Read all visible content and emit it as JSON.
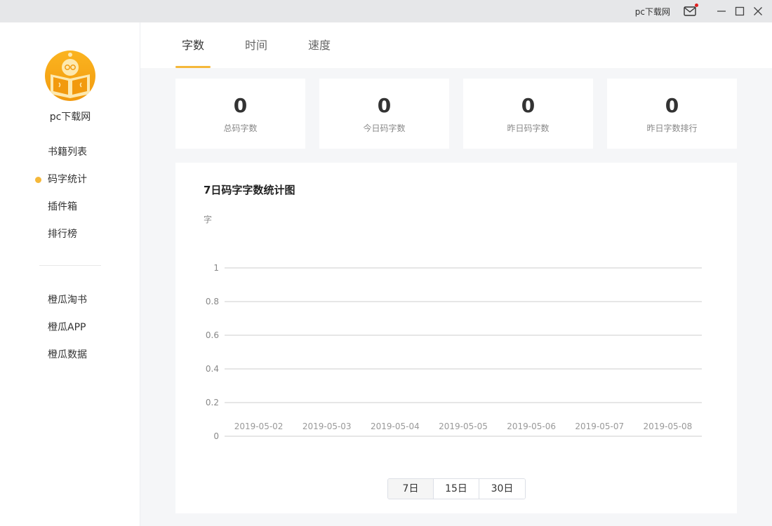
{
  "titlebar": {
    "user_label": "pc下载网",
    "icons": [
      "mail-icon",
      "minimize-icon",
      "maximize-icon",
      "close-icon"
    ],
    "notification_dot_color": "#e02020"
  },
  "sidebar": {
    "brand": "pc下载网",
    "primary_items": [
      {
        "label": "书籍列表",
        "active": false
      },
      {
        "label": "码字统计",
        "active": true
      },
      {
        "label": "插件箱",
        "active": false
      },
      {
        "label": "排行榜",
        "active": false
      }
    ],
    "secondary_items": [
      {
        "label": "橙瓜淘书"
      },
      {
        "label": "橙瓜APP"
      },
      {
        "label": "橙瓜数据"
      }
    ]
  },
  "tabs": [
    {
      "label": "字数",
      "active": true
    },
    {
      "label": "时间",
      "active": false
    },
    {
      "label": "速度",
      "active": false
    }
  ],
  "stats": [
    {
      "value": "0",
      "label": "总码字数"
    },
    {
      "value": "0",
      "label": "今日码字数"
    },
    {
      "value": "0",
      "label": "昨日码字数"
    },
    {
      "value": "0",
      "label": "昨日字数排行"
    }
  ],
  "chart_data": {
    "type": "line",
    "title": "7日码字字数统计图",
    "ylabel": "字",
    "xlabel": "",
    "categories": [
      "2019-05-02",
      "2019-05-03",
      "2019-05-04",
      "2019-05-05",
      "2019-05-06",
      "2019-05-07",
      "2019-05-08"
    ],
    "series": [
      {
        "values": [
          0,
          0,
          0,
          0,
          0,
          0,
          0
        ]
      }
    ],
    "yticks": [
      "0",
      "0.2",
      "0.4",
      "0.6",
      "0.8",
      "1"
    ],
    "ylim": [
      0,
      1
    ],
    "grid": true
  },
  "range_buttons": [
    {
      "label": "7日",
      "active": true
    },
    {
      "label": "15日",
      "active": false
    },
    {
      "label": "30日",
      "active": false
    }
  ],
  "colors": {
    "accent": "#f5b83a",
    "logo": "#f29a0e",
    "background": "#f5f6f8"
  }
}
